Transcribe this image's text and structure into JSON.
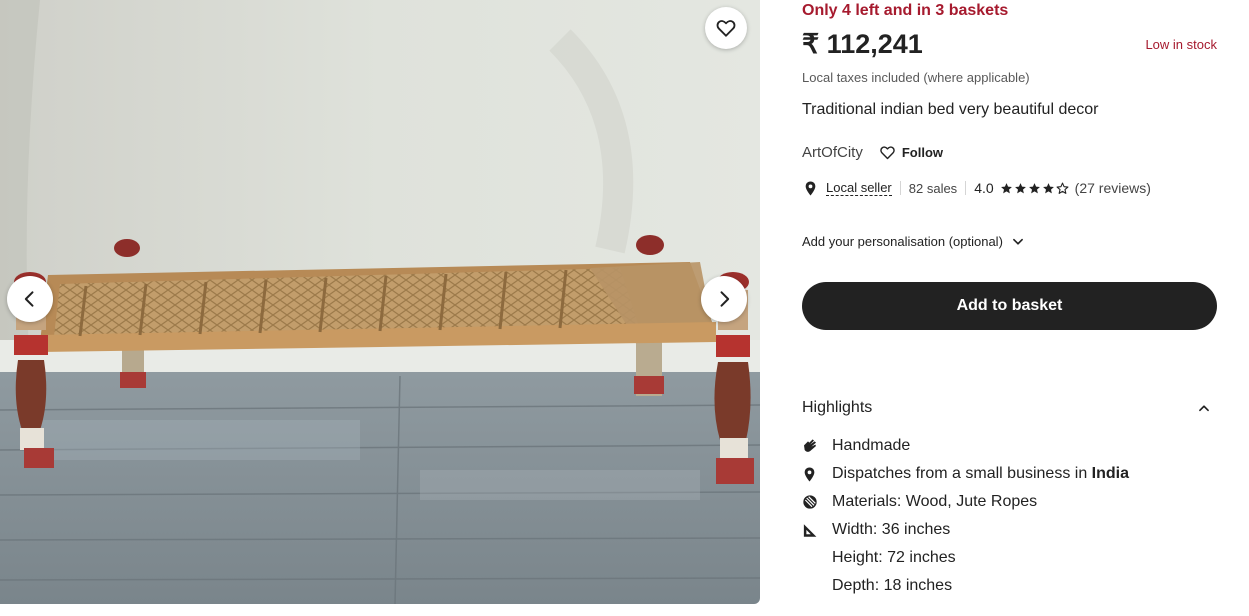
{
  "gallery": {
    "image_alt": "Traditional indian bed very beautiful decor",
    "favourite_icon": "heart-outline-icon",
    "prev_icon": "chevron-left-icon",
    "next_icon": "chevron-right-icon"
  },
  "listing": {
    "stock_alert": "Only 4 left and in 3 baskets",
    "price": "₹ 112,241",
    "stock_badge": "Low in stock",
    "tax_note": "Local taxes included (where applicable)",
    "title": "Traditional indian bed very beautiful decor"
  },
  "shop": {
    "name": "ArtOfCity",
    "follow_label": "Follow",
    "local_seller_label": "Local seller",
    "sales": "82 sales",
    "rating_value": "4.0",
    "rating_stars": 4,
    "rating_max": 5,
    "reviews": "(27 reviews)"
  },
  "personalisation": {
    "label": "Add your personalisation (optional)"
  },
  "actions": {
    "add_to_basket": "Add to basket"
  },
  "highlights": {
    "title": "Highlights",
    "items": [
      {
        "icon": "hand-icon",
        "text": "Handmade"
      },
      {
        "icon": "location-pin-icon",
        "text": "Dispatches from a small business in ",
        "bold": "India"
      },
      {
        "icon": "materials-icon",
        "text": "Materials: Wood, Jute Ropes"
      },
      {
        "icon": "ruler-triangle-icon",
        "text": "Width: 36 inches"
      },
      {
        "icon": "",
        "text": "Height: 72 inches"
      },
      {
        "icon": "",
        "text": "Depth: 18 inches"
      }
    ]
  },
  "colors": {
    "alert_red": "#a61a2e",
    "button_dark": "#222222",
    "text_muted": "#595959"
  }
}
